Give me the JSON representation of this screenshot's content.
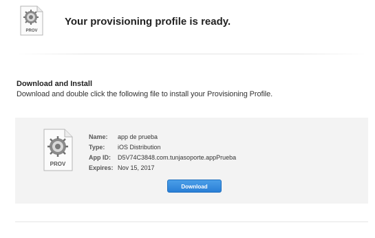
{
  "header": {
    "title": "Your provisioning profile is ready.",
    "icon_label": "PROV"
  },
  "section": {
    "title": "Download and Install",
    "description": "Download and double click the following file to install your Provisioning Profile."
  },
  "profile": {
    "icon_label": "PROV",
    "fields": [
      {
        "label": "Name:",
        "value": "app de prueba"
      },
      {
        "label": "Type:",
        "value": "iOS Distribution"
      },
      {
        "label": "App ID:",
        "value": "D5V74C3848.com.tunjasoporte.appPrueba"
      },
      {
        "label": "Expires:",
        "value": "Nov 15, 2017"
      }
    ],
    "download_label": "Download"
  },
  "colors": {
    "button": "#2a7fd6",
    "panel": "#f3f3f3"
  }
}
